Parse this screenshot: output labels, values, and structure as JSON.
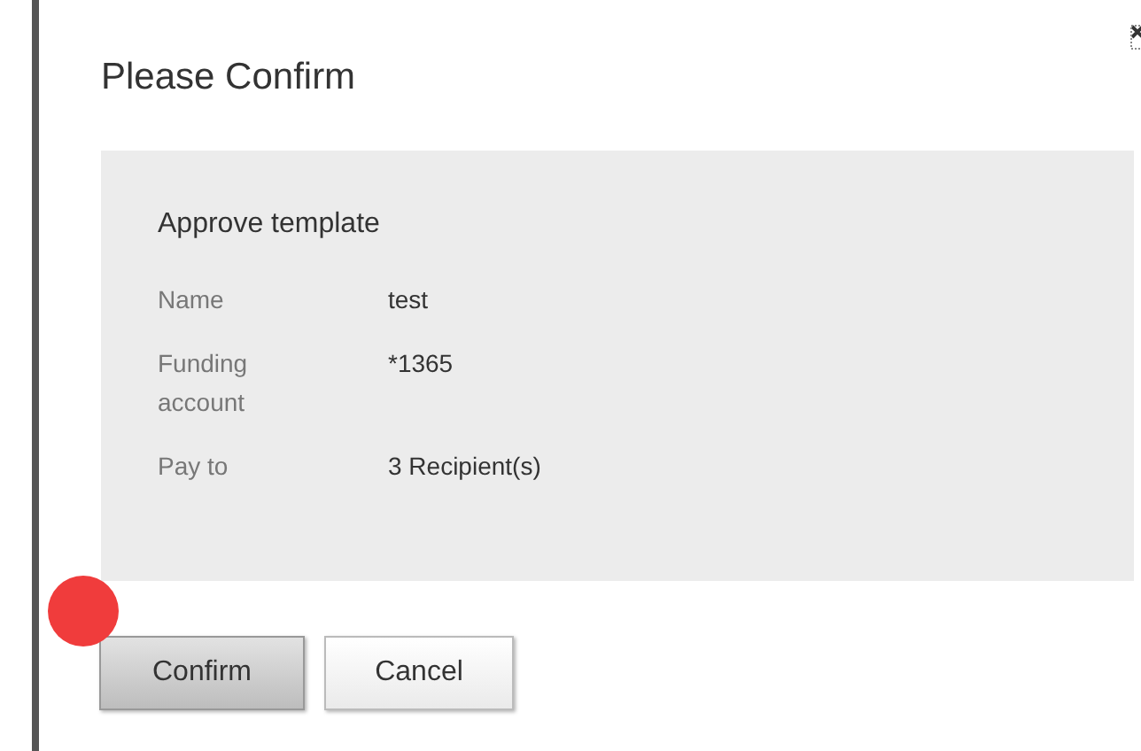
{
  "dialog": {
    "title": "Please Confirm",
    "section": {
      "heading": "Approve template",
      "fields": [
        {
          "label": "Name",
          "value": "test"
        },
        {
          "label": "Funding account",
          "value": "*1365"
        },
        {
          "label": "Pay to",
          "value": "3 Recipient(s)"
        }
      ]
    },
    "buttons": [
      {
        "label": "Confirm",
        "kind": "primary"
      },
      {
        "label": "Cancel",
        "kind": "secondary"
      }
    ]
  }
}
